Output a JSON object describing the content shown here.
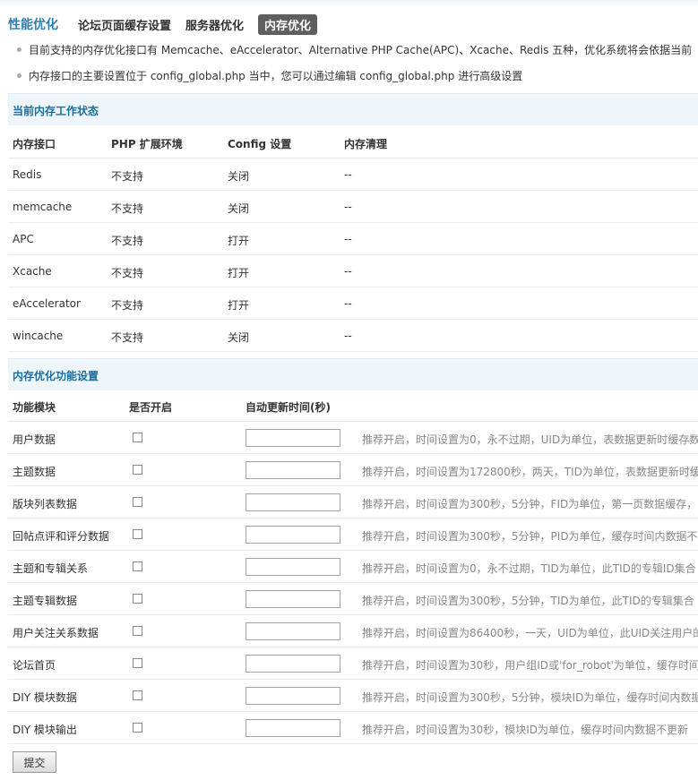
{
  "header": {
    "title": "性能优化",
    "tabs": [
      "论坛页面缓存设置",
      "服务器优化",
      "内存优化"
    ]
  },
  "tips": [
    "目前支持的内存优化接口有 Memcache、eAccelerator、Alternative PHP Cache(APC)、Xcache、Redis 五种，优化系统将会依据当前",
    "内存接口的主要设置位于 config_global.php 当中，您可以通过编辑 config_global.php 进行高级设置"
  ],
  "status": {
    "section_title": "当前内存工作状态",
    "columns": [
      "内存接口",
      "PHP 扩展环境",
      "Config 设置",
      "内存清理"
    ],
    "rows": [
      [
        "Redis",
        "不支持",
        "关闭",
        "--"
      ],
      [
        "memcache",
        "不支持",
        "关闭",
        "--"
      ],
      [
        "APC",
        "不支持",
        "打开",
        "--"
      ],
      [
        "Xcache",
        "不支持",
        "打开",
        "--"
      ],
      [
        "eAccelerator",
        "不支持",
        "打开",
        "--"
      ],
      [
        "wincache",
        "不支持",
        "关闭",
        "--"
      ]
    ]
  },
  "settings": {
    "section_title": "内存优化功能设置",
    "columns": [
      "功能模块",
      "是否开启",
      "自动更新时间(秒)"
    ],
    "rows": [
      {
        "name": "用户数据",
        "desc": "推荐开启，时间设置为0，永不过期，UID为单位，表数据更新时缓存数"
      },
      {
        "name": "主题数据",
        "desc": "推荐开启，时间设置为172800秒，两天，TID为单位，表数据更新时缓"
      },
      {
        "name": "版块列表数据",
        "desc": "推荐开启，时间设置为300秒，5分钟，FID为单位，第一页数据缓存，"
      },
      {
        "name": "回帖点评和评分数据",
        "desc": "推荐开启，时间设置为300秒，5分钟，PID为单位，缓存时间内数据不"
      },
      {
        "name": "主题和专辑关系",
        "desc": "推荐开启，时间设置为0，永不过期，TID为单位，此TID的专辑ID集合"
      },
      {
        "name": "主题专辑数据",
        "desc": "推荐开启，时间设置为300秒，5分钟，TID为单位，此TID的专辑集合"
      },
      {
        "name": "用户关注关系数据",
        "desc": "推荐开启，时间设置为86400秒，一天，UID为单位，此UID关注用户的"
      },
      {
        "name": "论坛首页",
        "desc": "推荐开启，时间设置为30秒，用户组ID或'for_robot'为单位，缓存时间"
      },
      {
        "name": "DIY 模块数据",
        "desc": "推荐开启，时间设置为300秒，5分钟，模块ID为单位，缓存时间内数据"
      },
      {
        "name": "DIY 模块输出",
        "desc": "推荐开启，时间设置为30秒，模块ID为单位，缓存时间内数据不更新"
      }
    ]
  },
  "submit_label": "提交"
}
